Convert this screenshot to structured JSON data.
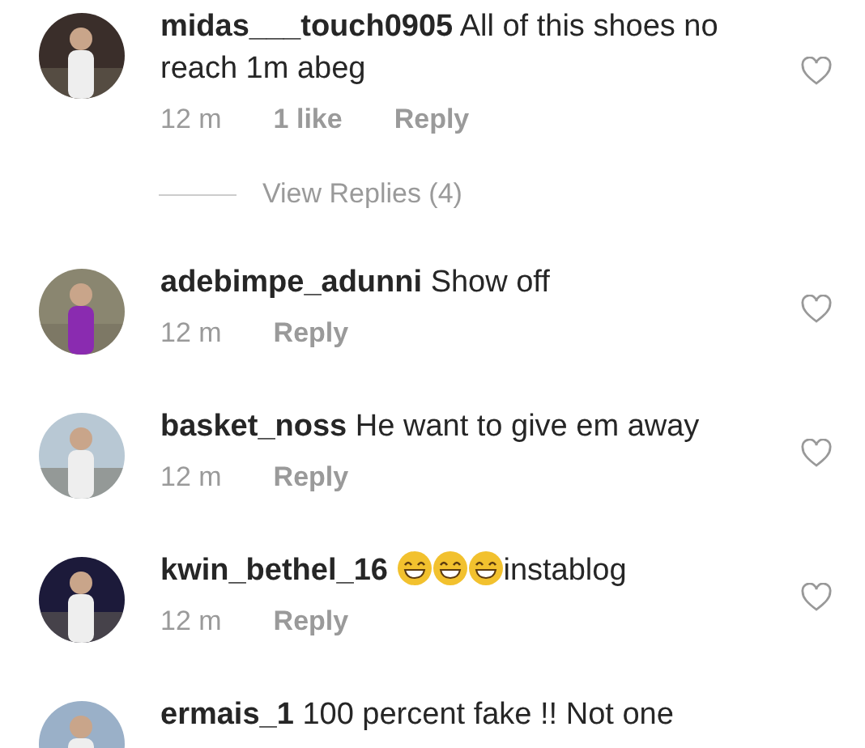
{
  "comments": [
    {
      "username": "midas___touch0905",
      "parts": [
        {
          "kind": "text",
          "text": "All of this shoes no reach 1m abeg"
        }
      ],
      "time": "12 m",
      "likes": "1 like",
      "reply": "Reply",
      "liked": false,
      "view_replies": "View Replies (4)"
    },
    {
      "username": "adebimpe_adunni",
      "parts": [
        {
          "kind": "text",
          "text": "Show off"
        }
      ],
      "time": "12 m",
      "reply": "Reply",
      "liked": false
    },
    {
      "username": "basket_noss",
      "parts": [
        {
          "kind": "text",
          "text": "He want to give em away"
        }
      ],
      "time": "12 m",
      "reply": "Reply",
      "liked": false
    },
    {
      "username": "kwin_bethel_16",
      "parts": [
        {
          "kind": "emoji"
        },
        {
          "kind": "emoji"
        },
        {
          "kind": "emoji"
        },
        {
          "kind": "text",
          "text": "instablog"
        }
      ],
      "time": "12 m",
      "reply": "Reply",
      "liked": false
    },
    {
      "username": "ermais_1",
      "parts": [
        {
          "kind": "text",
          "text": "100 percent fake !! Not one"
        }
      ]
    }
  ]
}
